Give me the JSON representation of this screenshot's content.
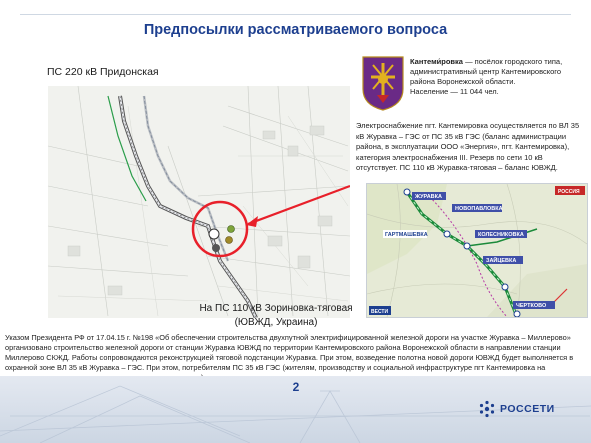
{
  "title": "Предпосылки рассматриваемого вопроса",
  "map_left": {
    "label_top": "ПС 220 кВ Придонская",
    "label_bottom_line1": "На ПС 110 кВ Зориновка-тяговая",
    "label_bottom_line2": "(ЮВЖД, Украина)"
  },
  "info": {
    "town_name": "Кантеми́ровка",
    "description": " — посёлок городского типа, административный центр Кантемировского района Воронежской области.",
    "population": "Население — 11 044 чел."
  },
  "supply_text": "Электроснабжение пгт. Кантемировка осуществляется по ВЛ 35 кВ Журавка – ГЭС от ПС 35 кВ ГЭС (баланс администрации района, в эксплуатации ООО «Энергия», пгт. Кантемировка), категория электроснабжения III. Резерв по сети 10 кВ отсутствует. ПС 110 кВ Журавка-тяговая – баланс ЮВЖД.",
  "map_right": {
    "labels": [
      "ЖУРАВКА",
      "НОВОПАВЛОВКА",
      "ГАРТМАШЕВКА",
      "КОЛЕСНИКОВКА",
      "ЗАЙЦЕВКА",
      "ЧЕРТКОВО"
    ],
    "corner_label_top": "РОССИЯ",
    "corner_label_bottom": "ВЕСТИ"
  },
  "bottom_text": "Указом Президента РФ от 17.04.15 г. №198 «Об обеспечении строительства двухпутной электрифицированной железной дороги на участке Журавка – Миллерово» организовано строительство железной дороги от станции Журавка ЮВЖД по территории Кантемировского района Воронежской области в направлении станции Миллерово СКЖД. Работы сопровождаются реконструкцией тяговой подстанции Журавка. При этом, возведение полотна новой дороги ЮВЖД будет выполняется в охранной зоне ВЛ 35 кВ Журавка – ГЭС. При этом, потребителям ПС 35 кВ ГЭС (жителям, производству и социальной инфраструктуре пгт Кантемировка на длительные сроки прекращается подача электроэнергии)",
  "page_number": "2",
  "logo_text": "РОССЕТИ",
  "colors": {
    "title": "#1d3f8f",
    "highlight": "#e8202a",
    "brand": "#1d3f8f",
    "rail": "#1b8a3a"
  }
}
